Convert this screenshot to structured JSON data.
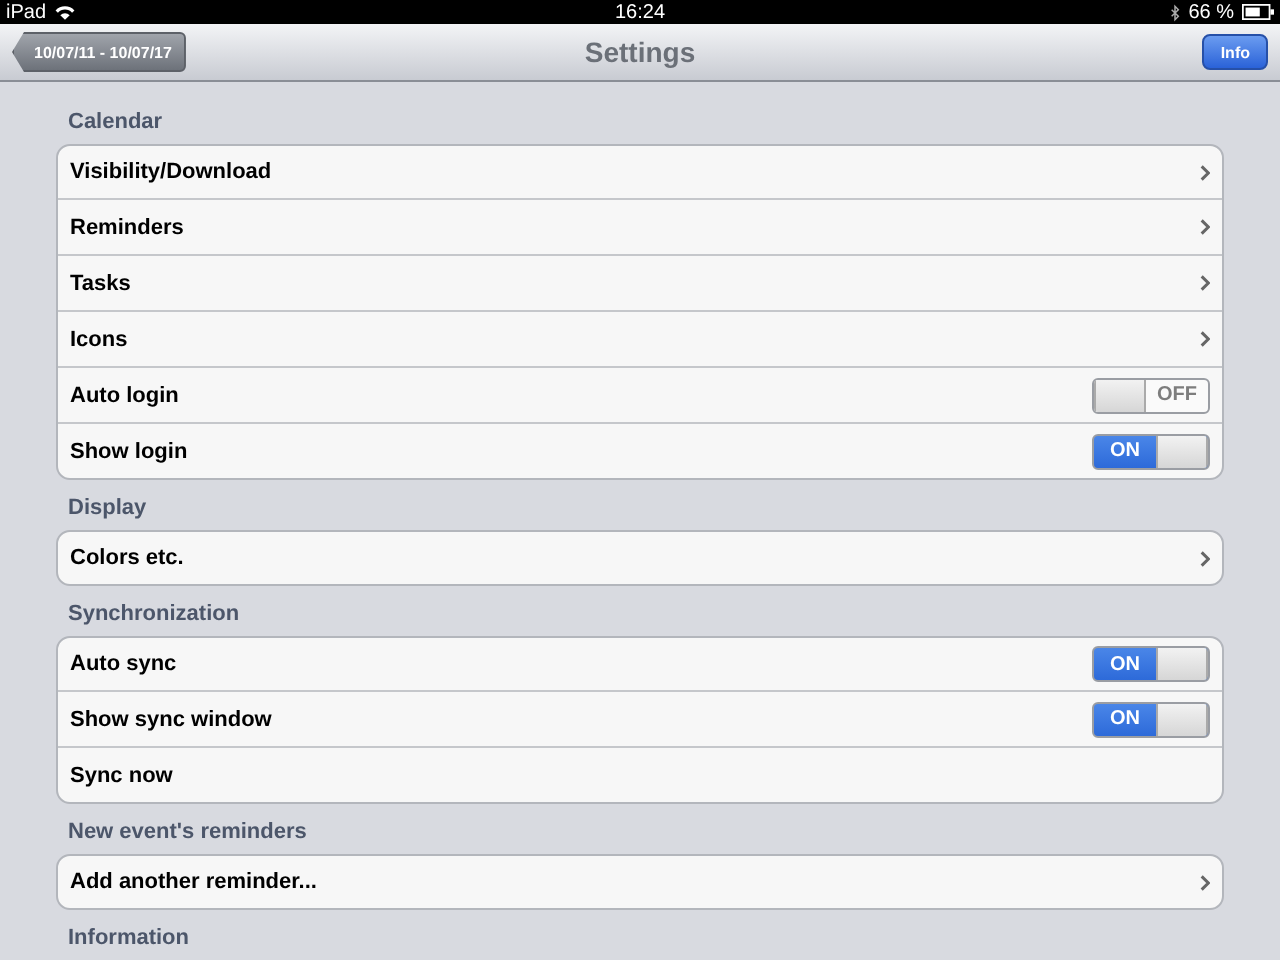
{
  "status_bar": {
    "device": "iPad",
    "time": "16:24",
    "battery": "66 %"
  },
  "nav_bar": {
    "back_button": "10/07/11 - 10/07/17",
    "title": "Settings",
    "right_button": "Info"
  },
  "sections": [
    {
      "header": "Calendar",
      "rows": [
        {
          "label": "Visibility/Download",
          "kind": "link"
        },
        {
          "label": "Reminders",
          "kind": "link"
        },
        {
          "label": "Tasks",
          "kind": "link"
        },
        {
          "label": "Icons",
          "kind": "link"
        },
        {
          "label": "Auto login",
          "kind": "toggle",
          "on": false,
          "switch_label": "OFF"
        },
        {
          "label": "Show login",
          "kind": "toggle",
          "on": true,
          "switch_label": "ON"
        }
      ]
    },
    {
      "header": "Display",
      "rows": [
        {
          "label": "Colors etc.",
          "kind": "link"
        }
      ]
    },
    {
      "header": "Synchronization",
      "rows": [
        {
          "label": "Auto sync",
          "kind": "toggle",
          "on": true,
          "switch_label": "ON"
        },
        {
          "label": "Show sync window",
          "kind": "toggle",
          "on": true,
          "switch_label": "ON"
        },
        {
          "label": "Sync now",
          "kind": "plain"
        }
      ]
    },
    {
      "header": "New event's reminders",
      "rows": [
        {
          "label": "Add another reminder...",
          "kind": "link"
        }
      ]
    },
    {
      "header": "Information"
    }
  ]
}
